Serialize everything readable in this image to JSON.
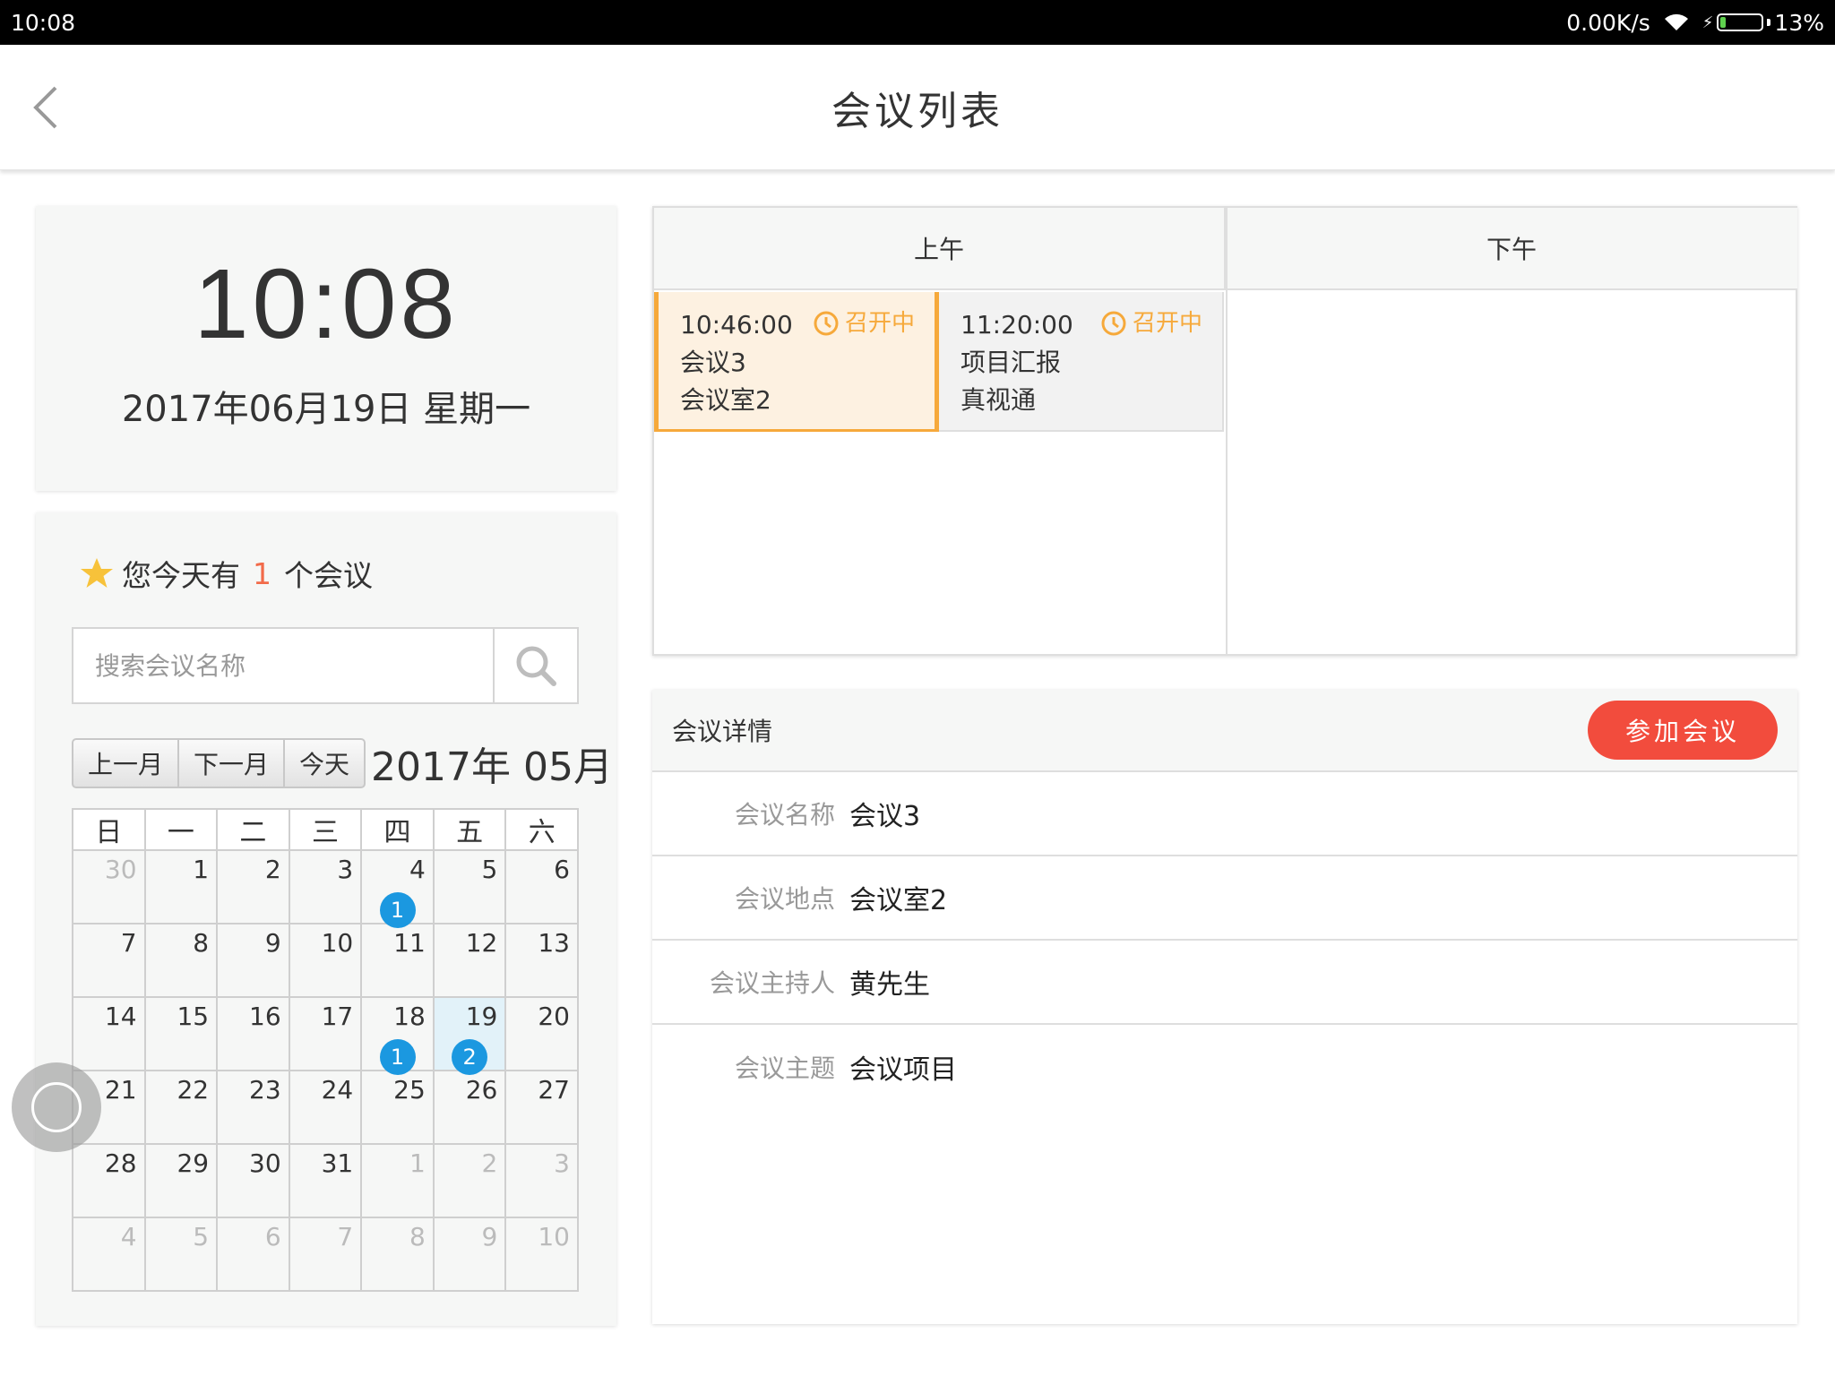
{
  "status_bar": {
    "time": "10:08",
    "speed": "0.00K/s",
    "battery": "13%",
    "battery_level": 0.13
  },
  "header": {
    "title": "会议列表"
  },
  "clock": {
    "time": "10:08",
    "date": "2017年06月19日  星期一"
  },
  "today": {
    "prefix": "您今天有",
    "count": "1",
    "suffix": "个会议"
  },
  "search": {
    "placeholder": "搜索会议名称"
  },
  "nav": {
    "prev": "上一月",
    "next": "下一月",
    "today": "今天",
    "month_label": "2017年 05月"
  },
  "calendar": {
    "weekdays": [
      "日",
      "一",
      "二",
      "三",
      "四",
      "五",
      "六"
    ],
    "weeks": [
      [
        {
          "d": "30",
          "o": true
        },
        {
          "d": "1"
        },
        {
          "d": "2"
        },
        {
          "d": "3"
        },
        {
          "d": "4",
          "badge": "1"
        },
        {
          "d": "5"
        },
        {
          "d": "6"
        }
      ],
      [
        {
          "d": "7"
        },
        {
          "d": "8"
        },
        {
          "d": "9"
        },
        {
          "d": "10"
        },
        {
          "d": "11"
        },
        {
          "d": "12"
        },
        {
          "d": "13"
        }
      ],
      [
        {
          "d": "14"
        },
        {
          "d": "15"
        },
        {
          "d": "16"
        },
        {
          "d": "17"
        },
        {
          "d": "18",
          "badge": "1"
        },
        {
          "d": "19",
          "badge": "2",
          "sel": true
        },
        {
          "d": "20"
        }
      ],
      [
        {
          "d": "21"
        },
        {
          "d": "22"
        },
        {
          "d": "23"
        },
        {
          "d": "24"
        },
        {
          "d": "25"
        },
        {
          "d": "26"
        },
        {
          "d": "27"
        }
      ],
      [
        {
          "d": "28"
        },
        {
          "d": "29"
        },
        {
          "d": "30"
        },
        {
          "d": "31"
        },
        {
          "d": "1",
          "o": true
        },
        {
          "d": "2",
          "o": true
        },
        {
          "d": "3",
          "o": true
        }
      ],
      [
        {
          "d": "4",
          "o": true
        },
        {
          "d": "5",
          "o": true
        },
        {
          "d": "6",
          "o": true
        },
        {
          "d": "7",
          "o": true
        },
        {
          "d": "8",
          "o": true
        },
        {
          "d": "9",
          "o": true
        },
        {
          "d": "10",
          "o": true
        }
      ]
    ]
  },
  "schedule": {
    "am_label": "上午",
    "pm_label": "下午",
    "meetings": [
      {
        "time": "10:46:00",
        "name": "会议3",
        "room": "会议室2",
        "status": "召开中"
      },
      {
        "time": "11:20:00",
        "name": "项目汇报",
        "room": "真视通",
        "status": "召开中"
      }
    ]
  },
  "details": {
    "title": "会议详情",
    "join_label": "参加会议",
    "rows": [
      {
        "label": "会议名称",
        "value": "会议3"
      },
      {
        "label": "会议地点",
        "value": "会议室2"
      },
      {
        "label": "会议主持人",
        "value": "黄先生"
      },
      {
        "label": "会议主题",
        "value": "会议项目"
      }
    ]
  },
  "colors": {
    "accent_orange": "#f6a93b",
    "join_red": "#f24c3d",
    "badge_blue": "#1b98e0",
    "count_red": "#f26b4a"
  }
}
